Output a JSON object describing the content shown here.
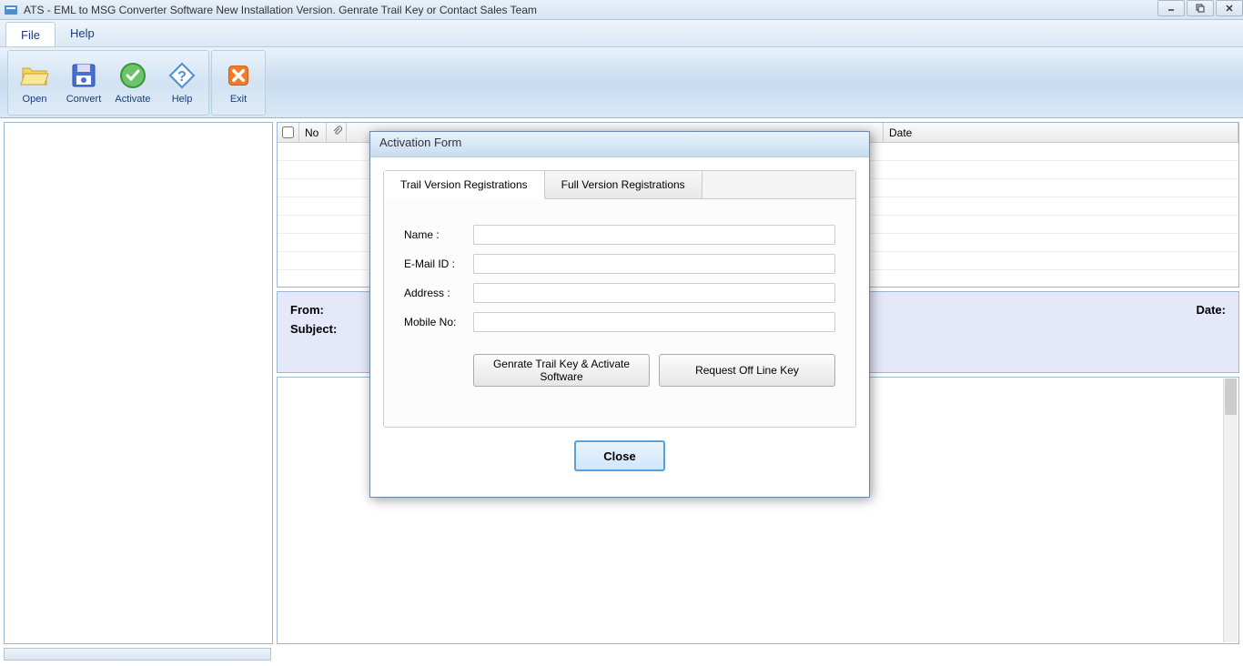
{
  "window": {
    "title": "ATS - EML to MSG Converter Software New Installation Version. Genrate Trail Key or Contact Sales Team"
  },
  "menu": {
    "file": "File",
    "help": "Help"
  },
  "toolbar": {
    "open": "Open",
    "convert": "Convert",
    "activate": "Activate",
    "help": "Help",
    "exit": "Exit"
  },
  "grid": {
    "no": "No",
    "date": "Date"
  },
  "info": {
    "from": "From:",
    "subject": "Subject:",
    "date": "Date:"
  },
  "dialog": {
    "title": "Activation Form",
    "tabs": {
      "trail": "Trail Version Registrations",
      "full": "Full Version Registrations"
    },
    "fields": {
      "name": "Name :",
      "email": "E-Mail ID :",
      "address": "Address :",
      "mobile": "Mobile No:"
    },
    "buttons": {
      "generate": "Genrate Trail Key & Activate Software",
      "request": "Request Off Line Key",
      "close": "Close"
    }
  }
}
